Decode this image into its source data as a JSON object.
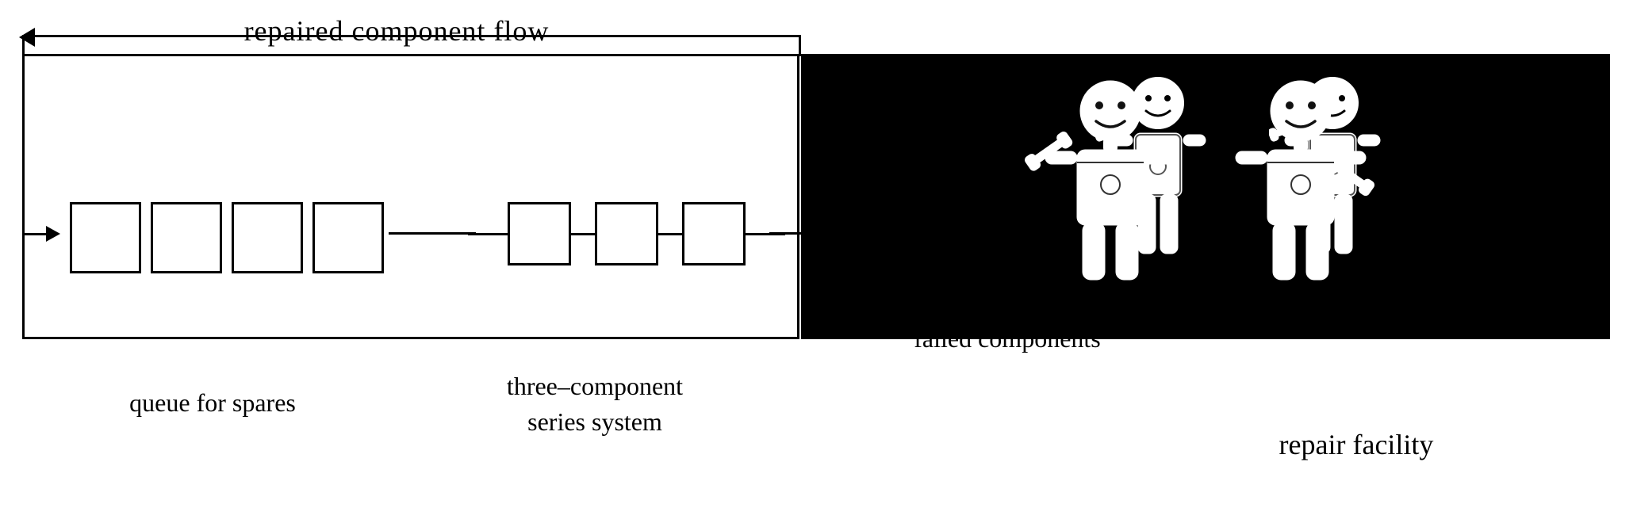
{
  "diagram": {
    "title": "repaired component flow",
    "spares_label": "queue for spares",
    "series_label": "three–component\nseries system",
    "failed_queue_label": "queue for\nfailed components",
    "repair_facility_label": "repair facility",
    "spares_box_count": 4,
    "series_box_count": 3
  }
}
